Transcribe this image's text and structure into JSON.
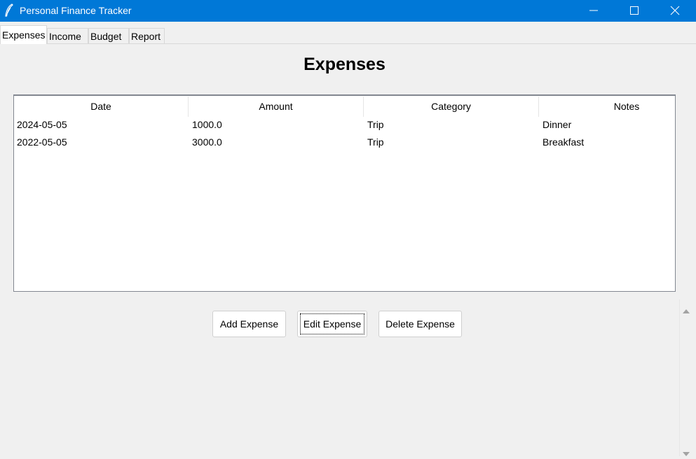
{
  "window": {
    "title": "Personal Finance Tracker",
    "accent_color": "#0078d7",
    "icon": "feather-icon"
  },
  "tabs": [
    {
      "label": "Expenses",
      "active": true
    },
    {
      "label": "Income",
      "active": false
    },
    {
      "label": "Budget",
      "active": false
    },
    {
      "label": "Report",
      "active": false
    }
  ],
  "main": {
    "heading": "Expenses",
    "table": {
      "columns": [
        "Date",
        "Amount",
        "Category",
        "Notes"
      ],
      "rows": [
        [
          "2024-05-05",
          "1000.0",
          "Trip",
          "Dinner"
        ],
        [
          "2022-05-05",
          "3000.0",
          "Trip",
          "Breakfast"
        ]
      ]
    },
    "buttons": {
      "add": "Add Expense",
      "edit": "Edit Expense",
      "delete": "Delete Expense"
    }
  }
}
